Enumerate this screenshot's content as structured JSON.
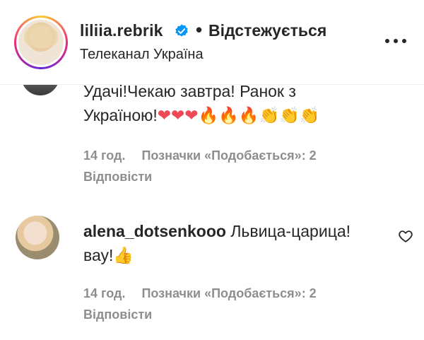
{
  "header": {
    "username": "liliia.rebrik",
    "separator": "•",
    "follow_status": "Відстежується",
    "subtitle": "Телеканал Україна",
    "more_icon": "more-horizontal-icon"
  },
  "comments": [
    {
      "line1": "Удачі!Чекаю завтра! Ранок з",
      "line2_text": "Україною!",
      "line2_emoji": "❤❤❤🔥🔥🔥👏👏👏",
      "time": "14 год.",
      "likes": "Позначки «Подобається»: 2",
      "reply": "Відповісти"
    },
    {
      "username": "alena_dotsenkooo",
      "text": "Львица-царица!",
      "line2_text": "вау!",
      "line2_emoji": "👍",
      "time": "14 год.",
      "likes": "Позначки «Подобається»: 2",
      "reply": "Відповісти",
      "like_icon": "heart-outline-icon"
    }
  ],
  "colors": {
    "text": "#262626",
    "secondary": "#8e8e8e",
    "verified": "#0095f6",
    "heart_red": "#ed4956"
  }
}
